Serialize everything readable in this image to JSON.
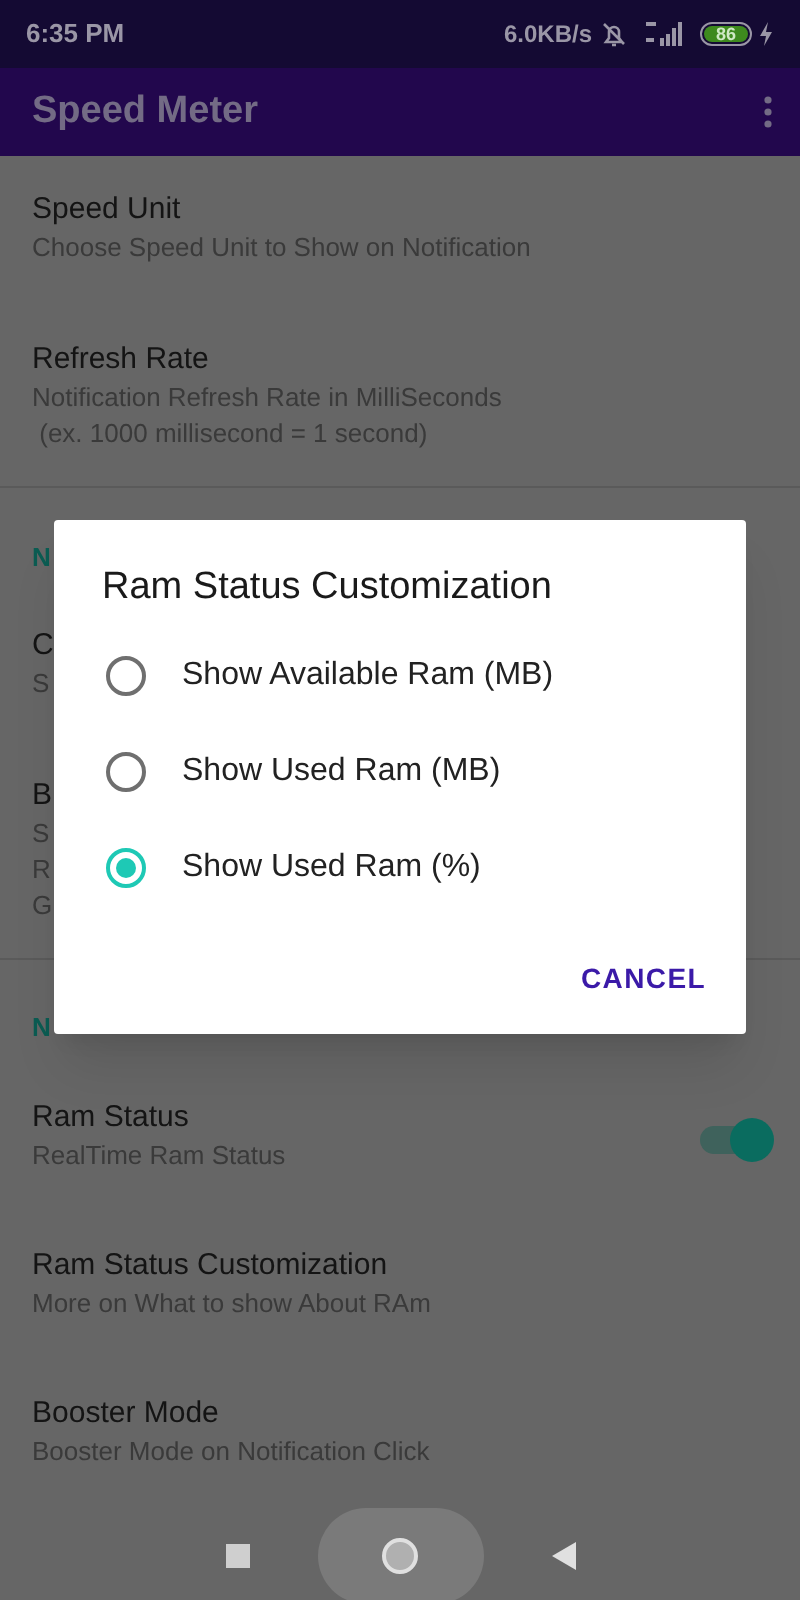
{
  "status_bar": {
    "time": "6:35 PM",
    "net_speed": "6.0KB/s",
    "battery": "86"
  },
  "app_bar": {
    "title": "Speed Meter"
  },
  "sections": [
    {
      "items": [
        {
          "title": "Speed Unit",
          "subtitle": "Choose Speed Unit to Show on Notification"
        },
        {
          "title": "Refresh Rate",
          "subtitle": "Notification Refresh Rate in MilliSeconds\n (ex. 1000 millisecond = 1 second)"
        }
      ]
    },
    {
      "header": "N",
      "items": [
        {
          "title": "C",
          "subtitle": "S"
        },
        {
          "title": "B",
          "subtitle": "S\nR\nG"
        }
      ]
    },
    {
      "header": "N",
      "items": [
        {
          "title": "Ram Status",
          "subtitle": "RealTime Ram Status",
          "switch": {
            "on": true
          }
        },
        {
          "title": "Ram Status Customization",
          "subtitle": "More on What to show About RAm"
        },
        {
          "title": "Booster Mode",
          "subtitle": "Booster Mode on Notification Click"
        }
      ]
    }
  ],
  "dialog": {
    "title": "Ram Status Customization",
    "options": [
      {
        "label": "Show Available Ram (MB)",
        "selected": false
      },
      {
        "label": "Show Used Ram (MB)",
        "selected": false
      },
      {
        "label": "Show Used Ram (%)",
        "selected": true
      }
    ],
    "button": "CANCEL"
  }
}
